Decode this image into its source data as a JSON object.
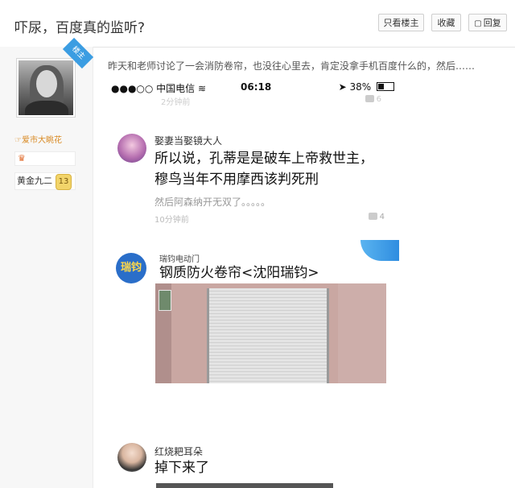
{
  "header": {
    "title": "吓尿，百度真的监听?",
    "btn_only_op": "只看楼主",
    "btn_favorite": "收藏",
    "btn_reply": "回复"
  },
  "sidebar": {
    "op_badge": "楼主",
    "username": "爱市大眺花",
    "rank_label": "黄金九二",
    "rank_level": "13"
  },
  "post": {
    "text": "昨天和老师讨论了一会消防卷帘，也没往心里去，肯定没拿手机百度什么的，然后……"
  },
  "screenshot": {
    "status": {
      "carrier": "●●●○○ 中国电信",
      "time": "06:18",
      "battery": "38%",
      "battery_level": 0.38
    },
    "ghost_time": "2分钟前",
    "ghost_count": "6",
    "comment1": {
      "name": "娶妻当娶镜大人",
      "line1": "所以说，孔蒂是是破车上帝救世主，",
      "line2": "穆鸟当年不用摩西该判死刑",
      "sub": "然后阿森纳开无双了。。。。。",
      "time": "10分钟前",
      "count": "4"
    },
    "ad": {
      "logo": "瑞钧",
      "brand": "瑞钧电动门",
      "title": "钢质防火卷帘<沈阳瑞钧>"
    },
    "comment2": {
      "name": "红烧耙耳朵",
      "text": "掉下来了"
    }
  }
}
